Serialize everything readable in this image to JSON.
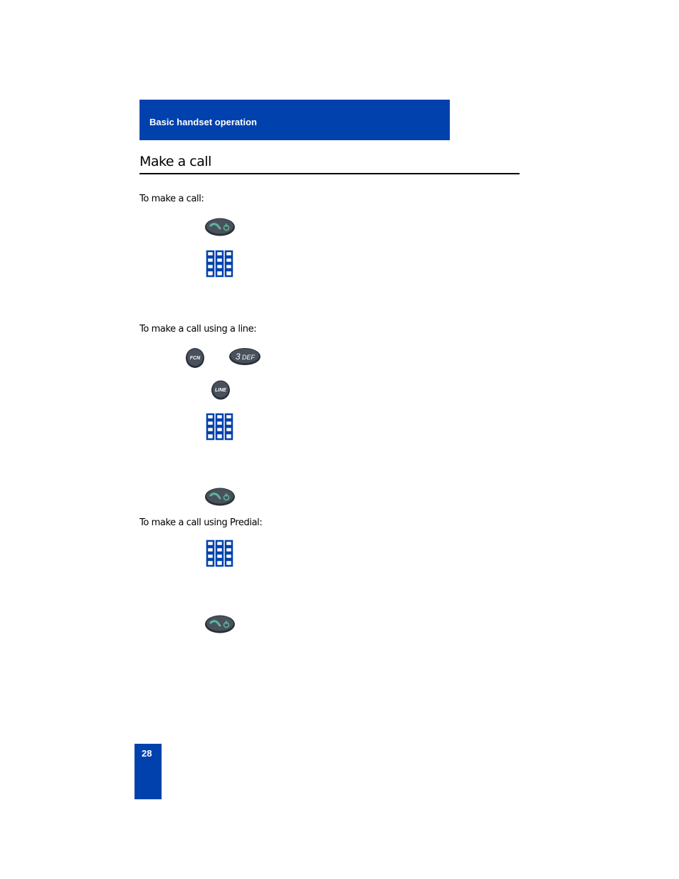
{
  "header": {
    "section_title": "Basic handset operation"
  },
  "page": {
    "title": "Make a call",
    "page_number": "28"
  },
  "sections": [
    {
      "label": "To make a call:",
      "steps": [
        "talk-power-key-icon",
        "keypad-icon"
      ]
    },
    {
      "label": "To make a call using a line:",
      "steps": [
        "fcn-key-icon",
        "3def-key-icon",
        "line-key-icon",
        "keypad-icon",
        "talk-power-key-icon"
      ]
    },
    {
      "label": "To make a call using Predial:",
      "steps": [
        "keypad-icon",
        "talk-power-key-icon"
      ]
    }
  ],
  "keys": {
    "fcn": "FCN",
    "three_def_digit": "3",
    "three_def_letters": "DEF",
    "line": "LINE"
  },
  "colors": {
    "brand_blue": "#0041ad",
    "key_dark": "#3d4550",
    "talk_green": "#5fb59a"
  }
}
